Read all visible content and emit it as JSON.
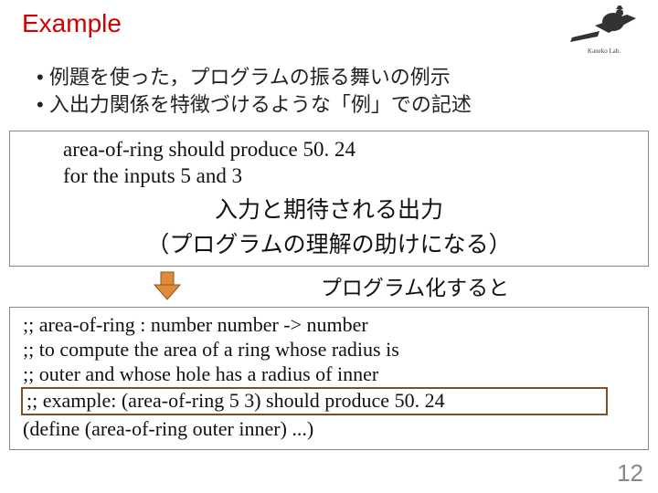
{
  "title": "Example",
  "bullets": {
    "b1": "例題を使った，プログラムの振る舞いの例示",
    "b2": "入出力関係を特徴づけるような「例」での記述"
  },
  "example_box": {
    "line1": "area-of-ring should produce 50. 24",
    "line2": "for the inputs 5 and 3",
    "annotation1": "入力と期待される出力",
    "annotation2": "（プログラムの理解の助けになる）"
  },
  "arrow_label": "プログラム化すると",
  "code": {
    "l1": ";; area-of-ring : number number -> number",
    "l2": ";; to compute the area of a ring whose radius is",
    "l3": ";; outer and whose hole has a radius of inner",
    "l4": ";; example: (area-of-ring 5 3) should produce 50. 24",
    "l5": "(define (area-of-ring outer inner) ...)"
  },
  "page_number": "12",
  "icons": {
    "logo_alt": "witch-logo",
    "arrow_alt": "down-arrow-icon"
  }
}
